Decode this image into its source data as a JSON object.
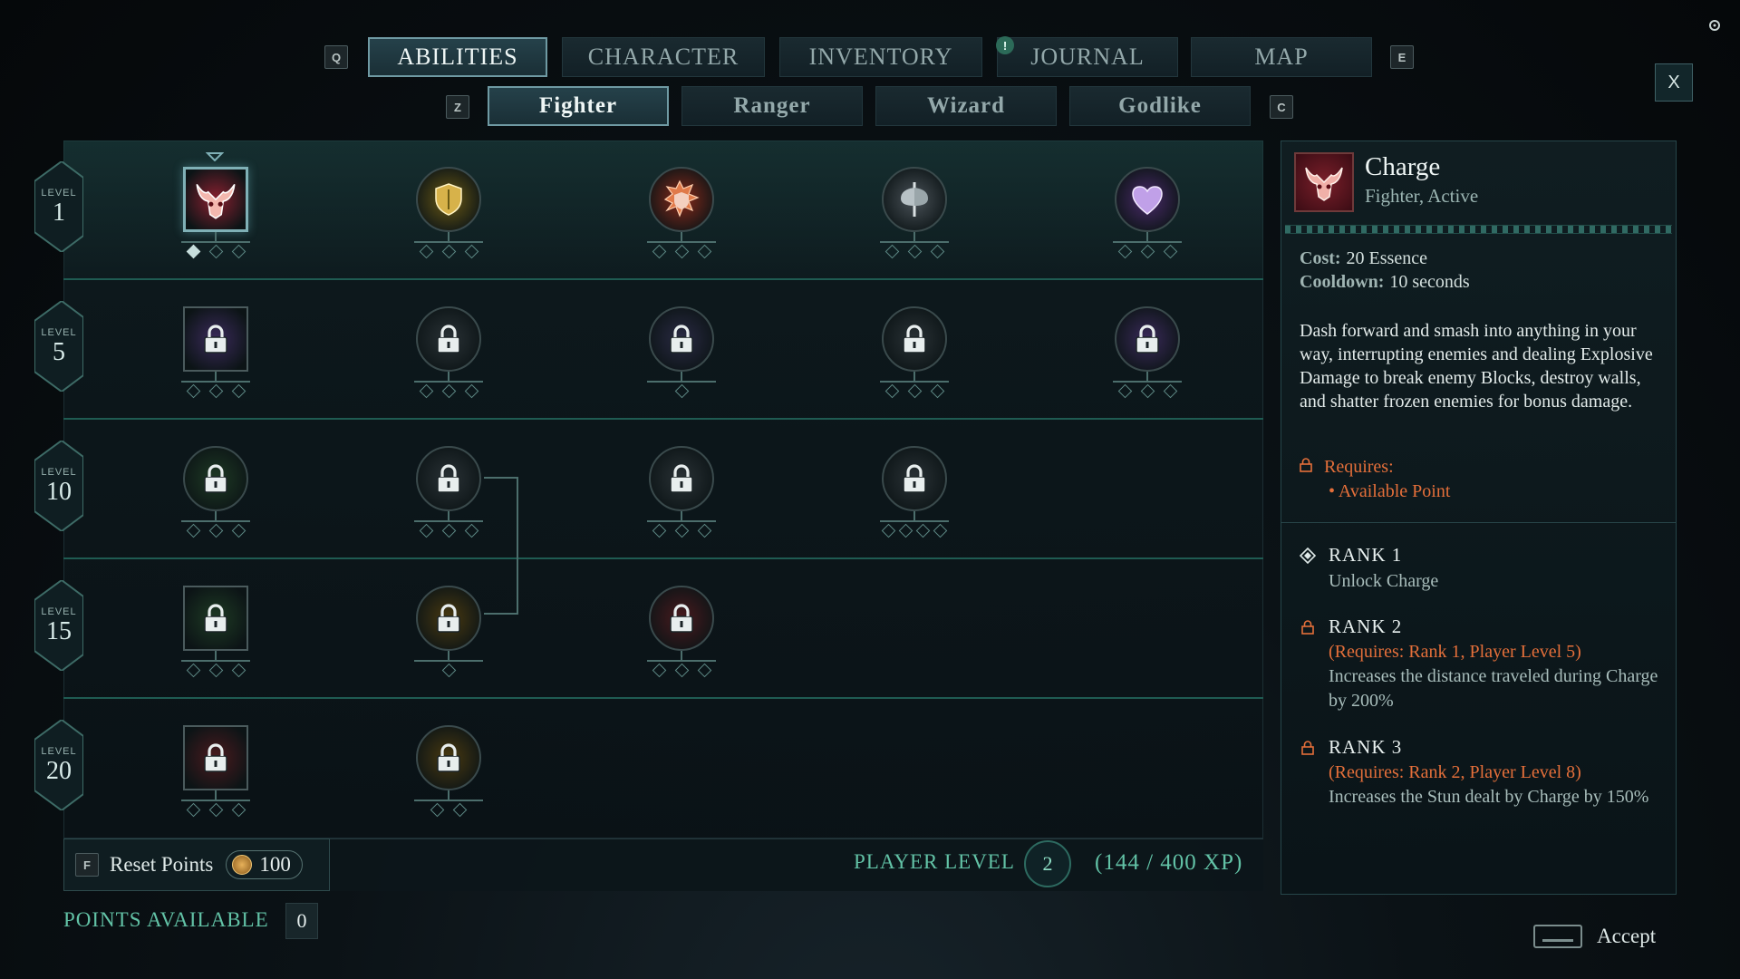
{
  "nav": {
    "prev_key": "Q",
    "next_key": "E",
    "tabs": [
      {
        "label": "ABILITIES",
        "active": true
      },
      {
        "label": "CHARACTER",
        "active": false
      },
      {
        "label": "INVENTORY",
        "active": false
      },
      {
        "label": "JOURNAL",
        "active": false,
        "notification": "!"
      },
      {
        "label": "MAP",
        "active": false
      }
    ],
    "close_label": "X"
  },
  "subnav": {
    "prev_key": "Z",
    "next_key": "C",
    "tabs": [
      {
        "label": "Fighter",
        "active": true
      },
      {
        "label": "Ranger",
        "active": false
      },
      {
        "label": "Wizard",
        "active": false
      },
      {
        "label": "Godlike",
        "active": false
      }
    ]
  },
  "levels": [
    {
      "label": "LEVEL",
      "value": "1"
    },
    {
      "label": "LEVEL",
      "value": "5"
    },
    {
      "label": "LEVEL",
      "value": "10"
    },
    {
      "label": "LEVEL",
      "value": "15"
    },
    {
      "label": "LEVEL",
      "value": "20"
    }
  ],
  "abilities": {
    "row1": [
      {
        "name": "charge",
        "shape": "square",
        "selected": true,
        "locked": false,
        "ranks": 3,
        "ranks_unlocked": 1,
        "color": "#8a2030",
        "icon": "bull-skull-icon"
      },
      {
        "name": "shield-bash",
        "shape": "circle",
        "locked": false,
        "ranks": 3,
        "ranks_unlocked": 0,
        "color": "#6b5a14",
        "icon": "shield-icon"
      },
      {
        "name": "shield-burst",
        "shape": "circle",
        "locked": false,
        "ranks": 3,
        "ranks_unlocked": 0,
        "color": "#8a2a1a",
        "icon": "burst-shield-icon"
      },
      {
        "name": "cleave",
        "shape": "circle",
        "locked": false,
        "ranks": 3,
        "ranks_unlocked": 0,
        "color": "#4a5258",
        "icon": "axe-icon"
      },
      {
        "name": "heart",
        "shape": "circle",
        "locked": false,
        "ranks": 3,
        "ranks_unlocked": 0,
        "color": "#4a2a6a",
        "icon": "heart-icon"
      }
    ],
    "row2": [
      {
        "shape": "square",
        "locked": true,
        "ranks": 3,
        "color": "#3a2a5a",
        "icon": "lock-icon"
      },
      {
        "shape": "circle",
        "locked": true,
        "ranks": 3,
        "color": "#2a3236",
        "icon": "lock-icon"
      },
      {
        "shape": "circle",
        "locked": true,
        "ranks": 1,
        "color": "#2a2a44",
        "icon": "lock-icon"
      },
      {
        "shape": "circle",
        "locked": true,
        "ranks": 3,
        "color": "#2a3236",
        "icon": "lock-icon"
      },
      {
        "shape": "circle",
        "locked": true,
        "ranks": 3,
        "color": "#3a2a5a",
        "icon": "lock-icon"
      }
    ],
    "row3": [
      {
        "shape": "circle",
        "locked": true,
        "ranks": 3,
        "color": "#1e3a24",
        "icon": "lock-icon"
      },
      {
        "shape": "circle",
        "locked": true,
        "ranks": 3,
        "color": "#2a3236",
        "icon": "lock-icon"
      },
      {
        "shape": "circle",
        "locked": true,
        "ranks": 3,
        "color": "#2a3236",
        "icon": "lock-icon"
      },
      {
        "shape": "circle",
        "locked": true,
        "ranks": 4,
        "color": "#2a3236",
        "icon": "lock-icon"
      }
    ],
    "row4": [
      {
        "shape": "square",
        "locked": true,
        "ranks": 3,
        "color": "#1e3a24",
        "icon": "lock-icon"
      },
      {
        "shape": "circle",
        "locked": true,
        "ranks": 1,
        "color": "#4a3a10",
        "icon": "lock-icon"
      },
      {
        "shape": "circle",
        "locked": true,
        "ranks": 3,
        "color": "#4a1a1e",
        "icon": "lock-icon"
      }
    ],
    "row5": [
      {
        "shape": "square",
        "locked": true,
        "ranks": 3,
        "color": "#4a1a1e",
        "icon": "lock-icon"
      },
      {
        "shape": "circle",
        "locked": true,
        "ranks": 2,
        "color": "#4a3a10",
        "icon": "lock-icon"
      }
    ]
  },
  "footer": {
    "reset_key": "F",
    "reset_label": "Reset Points",
    "reset_cost": "100",
    "player_level_label": "PLAYER LEVEL",
    "player_level": "2",
    "xp": "(144 / 400 XP)",
    "points_label": "POINTS AVAILABLE",
    "points_value": "0",
    "accept_label": "Accept"
  },
  "detail": {
    "title": "Charge",
    "subtitle": "Fighter, Active",
    "cost_label": "Cost:",
    "cost_value": "20 Essence",
    "cooldown_label": "Cooldown:",
    "cooldown_value": "10 seconds",
    "description": "Dash forward and smash into anything in your way, interrupting enemies and dealing Explosive Damage to break enemy Blocks, destroy walls, and shatter frozen enemies for bonus damage.",
    "requires_label": "Requires:",
    "requires_item": "• Available Point",
    "ranks": [
      {
        "title": "RANK 1",
        "requirement": "",
        "effect": "Unlock Charge"
      },
      {
        "title": "RANK 2",
        "requirement": "(Requires: Rank 1, Player Level 5)",
        "effect": "Increases the distance traveled during Charge by 200%"
      },
      {
        "title": "RANK 3",
        "requirement": "(Requires: Rank 2, Player Level 8)",
        "effect": "Increases the Stun dealt by Charge by 150%"
      }
    ]
  },
  "colors": {
    "accent": "#62c2a6",
    "warning": "#e46f3a",
    "panel_border": "#26464a"
  }
}
